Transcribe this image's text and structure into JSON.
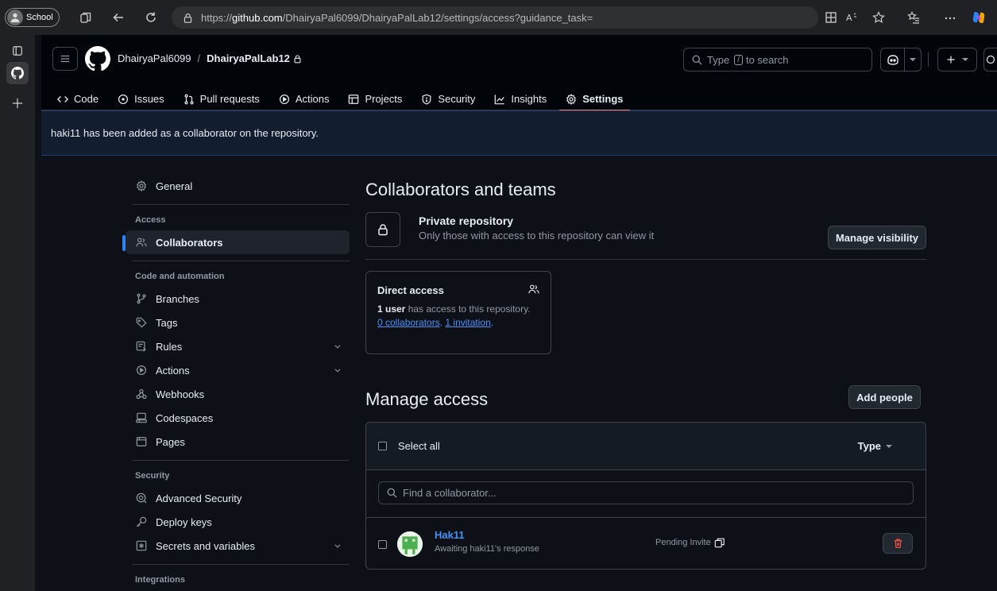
{
  "browser": {
    "profile_label": "School",
    "url_prefix": "https://",
    "url_host": "github.com",
    "url_path": "/DhairyaPal6099/DhairyaPalLab12/settings/access?guidance_task="
  },
  "header": {
    "owner": "DhairyaPal6099",
    "separator": "/",
    "repo": "DhairyaPalLab12",
    "search_prefix": "Type",
    "search_key": "/",
    "search_suffix": "to search"
  },
  "nav": {
    "tabs": [
      {
        "label": "Code",
        "icon": "code-icon"
      },
      {
        "label": "Issues",
        "icon": "issue-icon"
      },
      {
        "label": "Pull requests",
        "icon": "pull-request-icon"
      },
      {
        "label": "Actions",
        "icon": "play-icon"
      },
      {
        "label": "Projects",
        "icon": "table-icon"
      },
      {
        "label": "Security",
        "icon": "shield-icon"
      },
      {
        "label": "Insights",
        "icon": "graph-icon"
      },
      {
        "label": "Settings",
        "icon": "gear-icon"
      }
    ]
  },
  "flash": {
    "message": "haki11 has been added as a collaborator on the repository."
  },
  "sidebar": {
    "general": "General",
    "access_heading": "Access",
    "collaborators": "Collaborators",
    "code_heading": "Code and automation",
    "branches": "Branches",
    "tags": "Tags",
    "rules": "Rules",
    "actions": "Actions",
    "webhooks": "Webhooks",
    "codespaces": "Codespaces",
    "pages": "Pages",
    "security_heading": "Security",
    "advanced_security": "Advanced Security",
    "deploy_keys": "Deploy keys",
    "secrets": "Secrets and variables",
    "integrations_heading": "Integrations"
  },
  "main": {
    "title": "Collaborators and teams",
    "private_title": "Private repository",
    "private_sub": "Only those with access to this repository can view it",
    "manage_visibility": "Manage visibility",
    "direct_title": "Direct access",
    "direct_count": "1 user",
    "direct_text": "has access to this repository.",
    "collaborators_link": "0 collaborators",
    "comma": ".",
    "invitation_link": "1 invitation",
    "period": ".",
    "manage_title": "Manage access",
    "add_people": "Add people",
    "select_all": "Select all",
    "type_label": "Type",
    "find_placeholder": "Find a collaborator...",
    "member": {
      "name": "Hak11",
      "status": "Awaiting haki11's response",
      "pending": "Pending Invite"
    }
  },
  "colors": {
    "accent_underline": "#f78166",
    "link": "#4493f8",
    "danger": "#f85149"
  }
}
